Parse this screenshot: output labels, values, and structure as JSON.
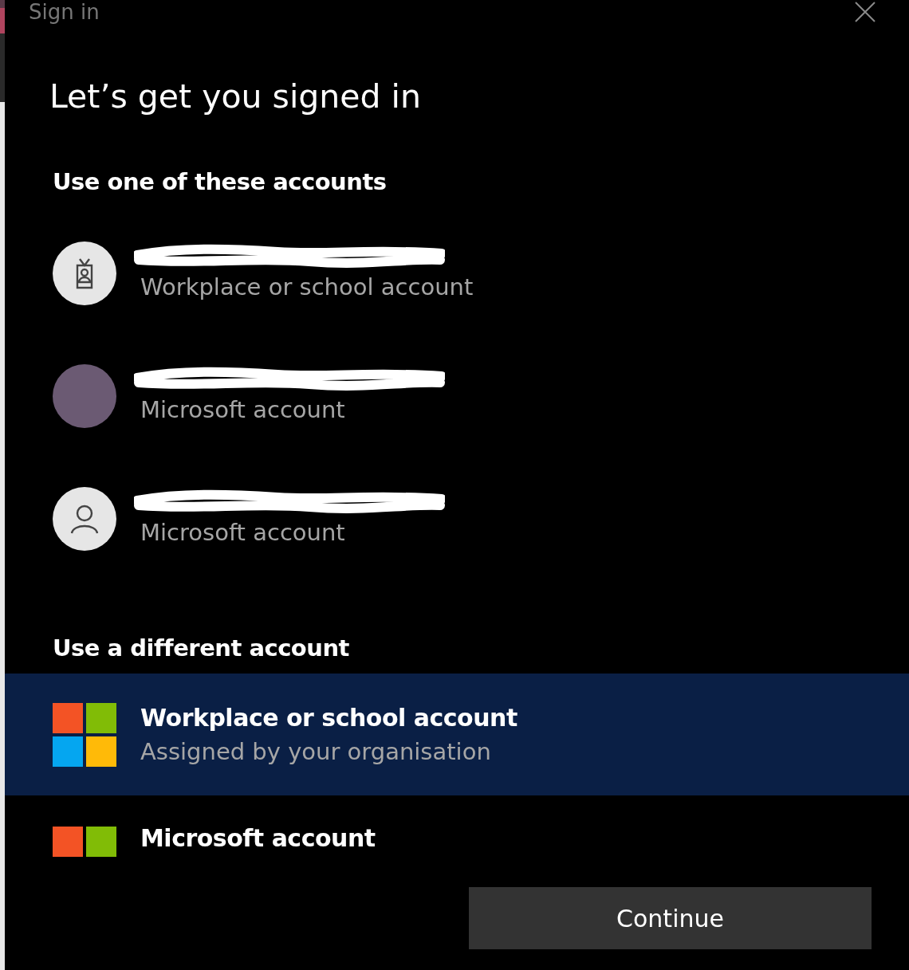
{
  "window": {
    "title": "Sign in"
  },
  "heading": "Let’s get you signed in",
  "saved_section": {
    "title": "Use one of these accounts",
    "accounts": [
      {
        "kind": "work",
        "subtitle": "Workplace or school account"
      },
      {
        "kind": "photo",
        "color": "#6b5a73",
        "subtitle": "Microsoft account"
      },
      {
        "kind": "person",
        "subtitle": "Microsoft account"
      }
    ]
  },
  "other_section": {
    "title": "Use a different account",
    "options": [
      {
        "title": "Workplace or school account",
        "subtitle": "Assigned by your organisation",
        "selected": true
      },
      {
        "title": "Microsoft account",
        "selected": false
      }
    ]
  },
  "buttons": [
    "Continue"
  ]
}
